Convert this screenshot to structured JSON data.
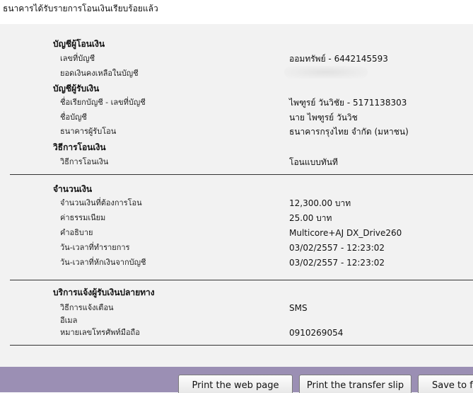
{
  "header": {
    "title": "ธนาคารได้รับรายการโอนเงินเรียบร้อยแล้ว"
  },
  "from_account": {
    "heading": "บัญชีผู้โอนเงิน",
    "account_number_label": "เลขที่บัญชี",
    "account_number_value": "ออมทรัพย์ - 6442145593",
    "balance_label": "ยอดเงินคงเหลือในบัญชี"
  },
  "to_account": {
    "heading": "บัญชีผู้รับเงิน",
    "name_number_label": "ชื่อเรียกบัญชี - เลขที่บัญชี",
    "name_number_value": "ไพฑูรย์ วันวิชัย - 5171138303",
    "account_name_label": "ชื่อบัญชี",
    "account_name_value": "นาย ไพฑูรย์ วันวิช",
    "bank_label": "ธนาคารผู้รับโอน",
    "bank_value": "ธนาคารกรุงไทย จำกัด (มหาชน)"
  },
  "transfer_method": {
    "heading": "วิธีการโอนเงิน",
    "method_label": "วิธีการโอนเงิน",
    "method_value": "โอนแบบทันที"
  },
  "amount": {
    "heading": "จำนวนเงิน",
    "transfer_amount_label": "จำนวนเงินที่ต้องการโอน",
    "transfer_amount_value": "12,300.00 บาท",
    "fee_label": "ค่าธรรมเนียม",
    "fee_value": "25.00  บาท",
    "description_label": "คำอธิบาย",
    "description_value": "Multicore+AJ DX_Drive260",
    "transaction_datetime_label": "วัน-เวลาที่ทำรายการ",
    "transaction_datetime_value": "03/02/2557 - 12:23:02",
    "debit_datetime_label": "วัน-เวลาที่หักเงินจากบัญชี",
    "debit_datetime_value": "03/02/2557 - 12:23:02"
  },
  "notification": {
    "heading": "บริการแจ้งผู้รับเงินปลายทาง",
    "method_label": "วิธีการแจ้งเตือน",
    "method_value": "SMS",
    "email_label": "อีเมล",
    "phone_label": "หมายเลขโทรศัพท์มือถือ",
    "phone_value": "0910269054"
  },
  "buttons": {
    "print_page": "Print the web page",
    "print_slip": "Print the transfer slip",
    "save": "Save to f"
  },
  "colors": {
    "panel_background": "#f2f2f2",
    "footer_background": "#9b8fb4"
  }
}
